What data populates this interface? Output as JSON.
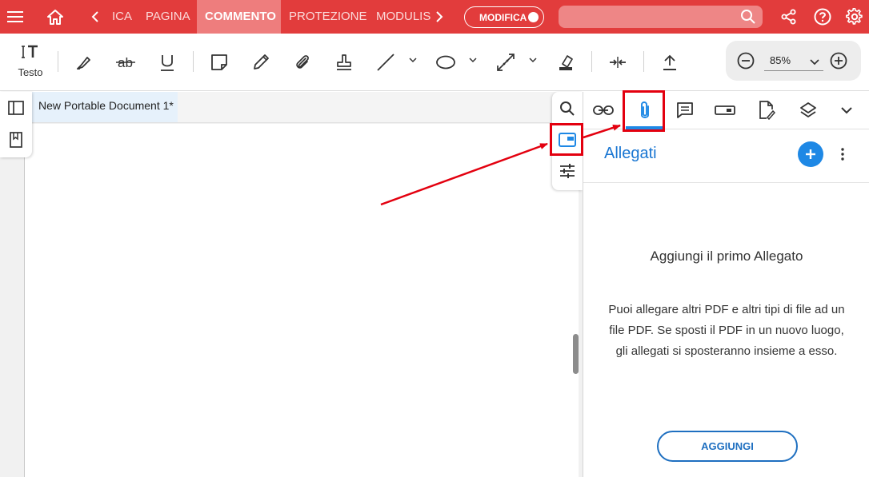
{
  "topbar": {
    "tabs": [
      {
        "label": "ICA",
        "active": false
      },
      {
        "label": "PAGINA",
        "active": false
      },
      {
        "label": "COMMENTO",
        "active": true
      },
      {
        "label": "PROTEZIONE",
        "active": false
      },
      {
        "label": "MODULIS",
        "active": false
      }
    ],
    "modify_label": "MODIFICA",
    "modify_on": true,
    "accent": "#e23c3c"
  },
  "toolbar": {
    "text_tool_label": "Testo",
    "icons": [
      "text-tool-icon",
      "highlighter-icon",
      "strikethrough-icon",
      "underline-icon",
      "sticky-note-icon",
      "pencil-icon",
      "paperclip-icon",
      "stamp-icon",
      "line-icon",
      "ellipse-icon",
      "measure-icon",
      "eraser-icon",
      "compare-icon",
      "upload-icon"
    ],
    "zoom": "85%"
  },
  "document": {
    "tab_title": "New Portable Document 1*"
  },
  "panel": {
    "title": "Allegati",
    "empty_title": "Aggiungi il primo Allegato",
    "empty_description": "Puoi allegare altri PDF e altri tipi di file ad un file PDF. Se sposti il PDF in un nuovo luogo, gli allegati si sposteranno insieme a esso.",
    "add_button": "AGGIUNGI",
    "active_tab": "attachments",
    "accent": "#1e88e5"
  },
  "annotations": {
    "highlight_color": "#e3000f"
  }
}
